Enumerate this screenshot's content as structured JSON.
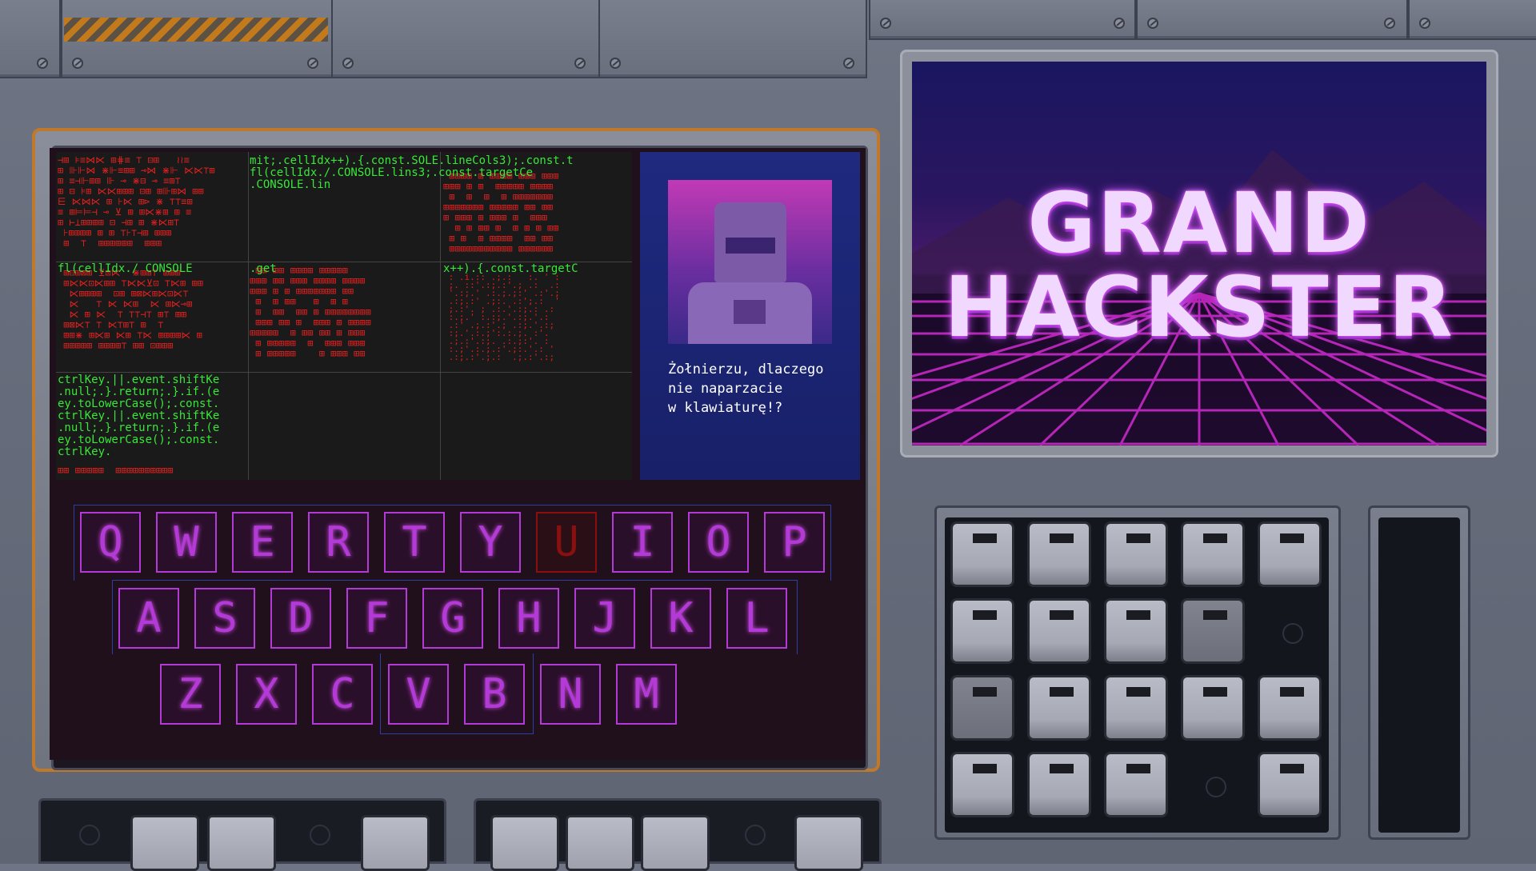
{
  "game_title": {
    "line1": "GRAND",
    "line2": "HACKSTER"
  },
  "dialog": {
    "text": "Żołnierzu, dlaczego\nnie naparzacie\nw klawiaturę!?"
  },
  "terminal": {
    "code_lines": [
      "mit;.cellIdx++).{.const.SOLE.lineCols3);.const.t",
      "fl(cellIdx./.CONSOLE.lins3;.const.targetCe",
      ".CONSOLE.lin"
    ],
    "mid_line_1": "fl(cellIdx./ CONSOLE",
    "mid_line_2": ".get",
    "mid_line_3": "x++).{.const.targetC",
    "bottom_lines": [
      "ctrlKey.||.event.shiftKe",
      ".null;.}.return;.}.if.(e",
      "ey.toLowerCase();.const.",
      "ctrlKey.||.event.shiftKe",
      ".null;.}.return;.}.if.(e",
      "ey.toLowerCase();.const.",
      "ctrlKey."
    ]
  },
  "keyboard": {
    "row1": [
      "Q",
      "W",
      "E",
      "R",
      "T",
      "Y",
      "U",
      "I",
      "O",
      "P"
    ],
    "row2": [
      "A",
      "S",
      "D",
      "F",
      "G",
      "H",
      "J",
      "K",
      "L"
    ],
    "row3": [
      "Z",
      "X",
      "C",
      "V",
      "B",
      "N",
      "M"
    ],
    "active_key": "U"
  },
  "colors": {
    "key_neon": "#b43ad8",
    "key_active": "#8a1010",
    "terminal_green": "#38e838",
    "terminal_red": "#e02020",
    "monitor_trim": "#c0782a"
  }
}
